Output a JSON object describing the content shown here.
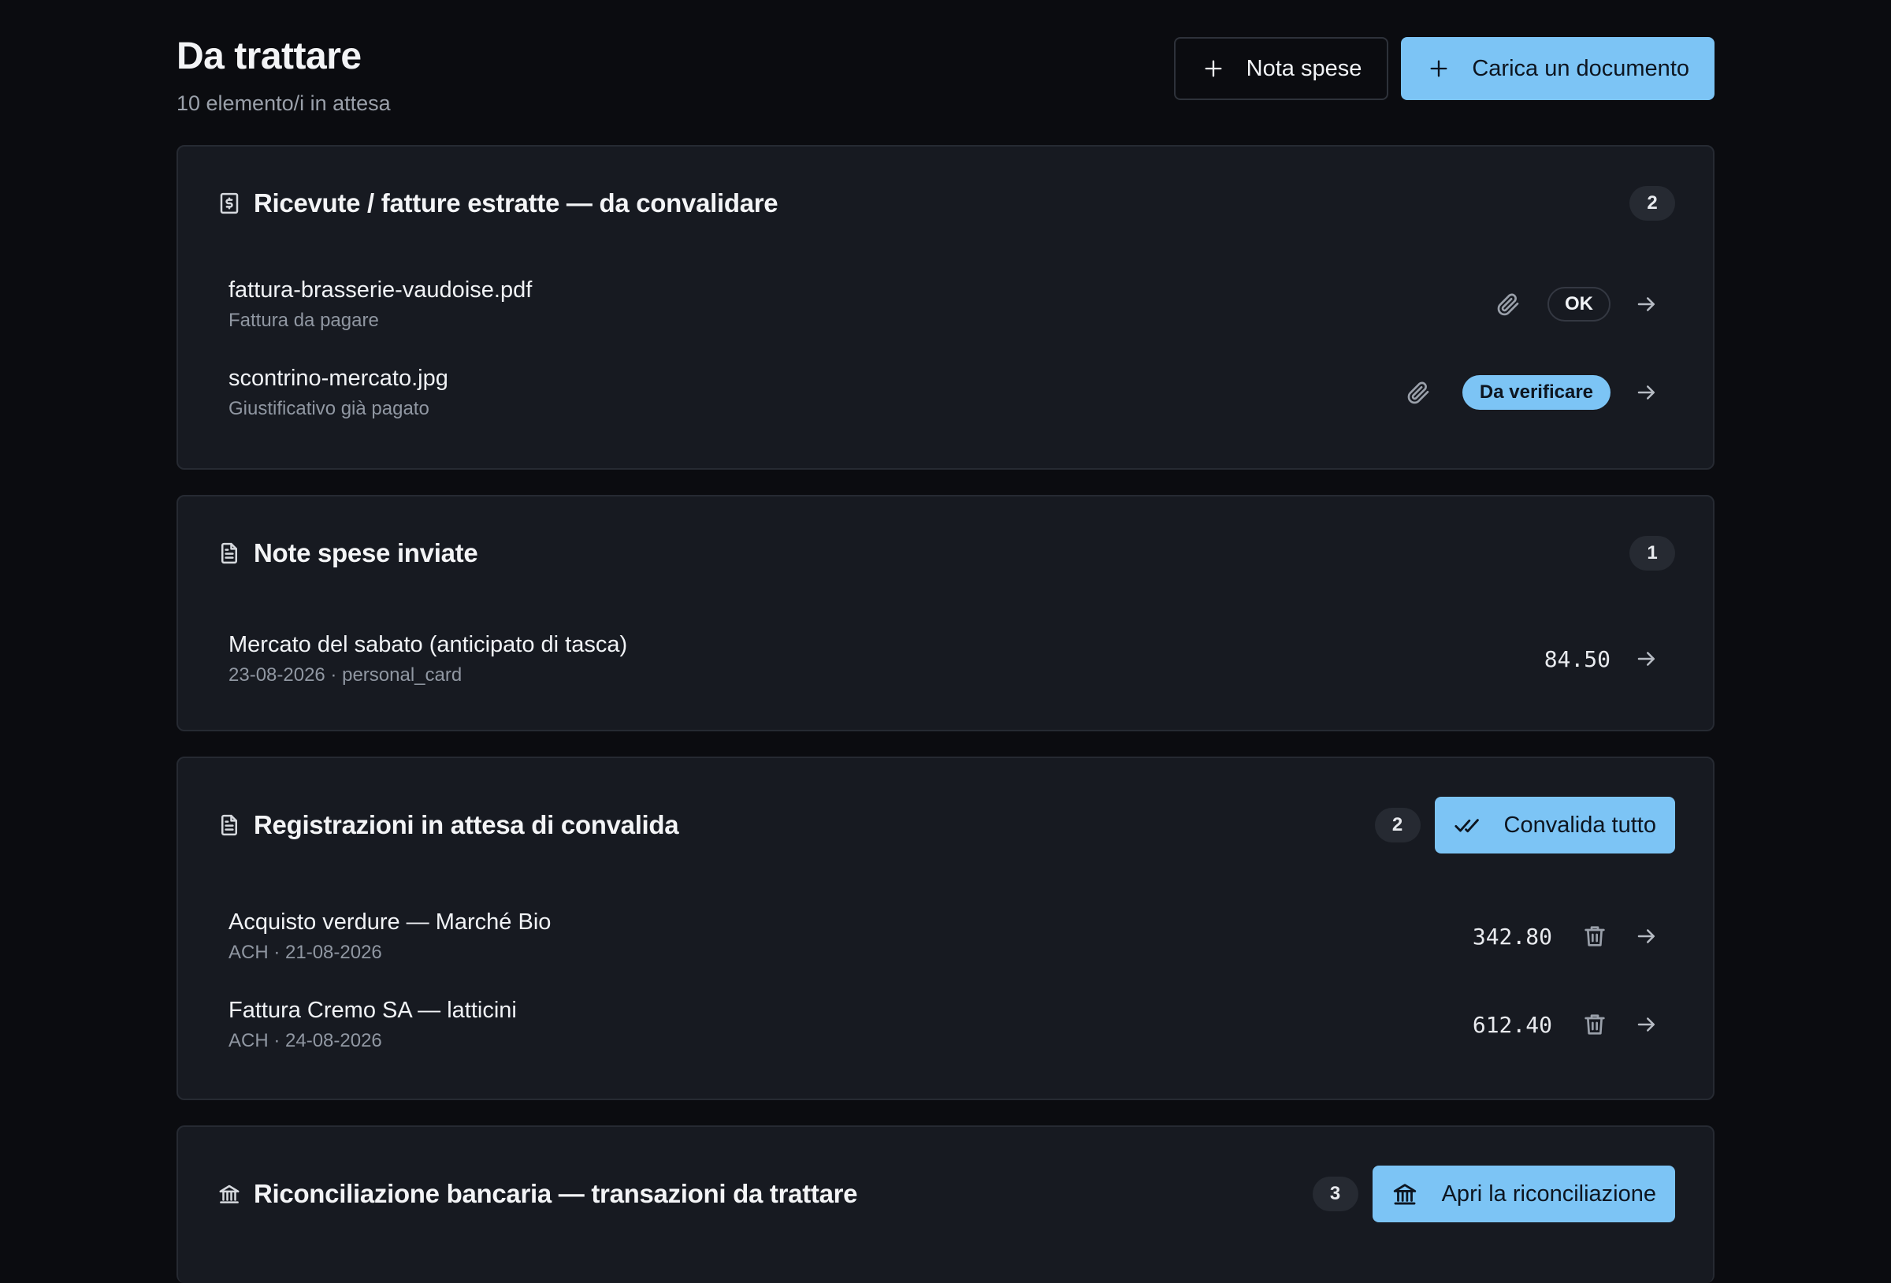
{
  "header": {
    "title": "Da trattare",
    "subtitle": "10 elemento/i in attesa",
    "expense_button": "Nota spese",
    "upload_button": "Carica un documento"
  },
  "sections": [
    {
      "title": "Ricevute / fatture estratte — da convalidare",
      "count": "2",
      "icon": "receipt-icon",
      "items": [
        {
          "title": "fattura-brasserie-vaudoise.pdf",
          "subtitle": "Fattura da pagare",
          "status": "OK"
        },
        {
          "title": "scontrino-mercato.jpg",
          "subtitle": "Giustificativo già pagato",
          "status": "Da verificare"
        }
      ]
    },
    {
      "title": "Note spese inviate",
      "count": "1",
      "icon": "document-icon",
      "items": [
        {
          "title": "Mercato del sabato (anticipato di tasca)",
          "subtitle": "23-08-2026 · personal_card",
          "amount": "84.50"
        }
      ]
    },
    {
      "title": "Registrazioni in attesa di convalida",
      "count": "2",
      "icon": "document-icon",
      "action": "Convalida tutto",
      "items": [
        {
          "title": "Acquisto verdure — Marché Bio",
          "subtitle": "ACH · 21-08-2026",
          "amount": "342.80"
        },
        {
          "title": "Fattura Cremo SA — latticini",
          "subtitle": "ACH · 24-08-2026",
          "amount": "612.40"
        }
      ]
    },
    {
      "title": "Riconciliazione bancaria — transazioni da trattare",
      "count": "3",
      "icon": "bank-icon",
      "action": "Apri la riconciliazione"
    }
  ],
  "colors": {
    "background": "#0b0c10",
    "card": "#171a21",
    "accent": "#7cc4f5"
  }
}
